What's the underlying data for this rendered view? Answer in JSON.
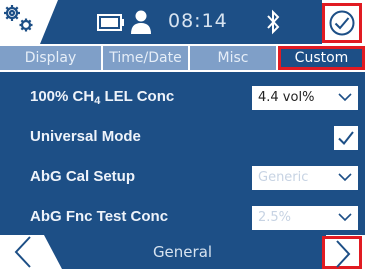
{
  "status_bar": {
    "time": "08:14",
    "icons": [
      "gears-icon",
      "battery-icon",
      "user-icon",
      "bluetooth-icon",
      "checkmark-circle-icon"
    ]
  },
  "tabs": [
    {
      "label": "Display",
      "active": false
    },
    {
      "label": "Time/Date",
      "active": false
    },
    {
      "label": "Misc",
      "active": false
    },
    {
      "label": "Custom",
      "active": true
    }
  ],
  "settings": {
    "lel_conc": {
      "label_main": "100% CH",
      "label_sub": "4",
      "label_tail": " LEL Conc",
      "value": "4.4 vol%"
    },
    "universal_mode": {
      "label": "Universal Mode",
      "checked": true
    },
    "abg_cal_setup": {
      "label": "AbG Cal Setup",
      "value": "Generic",
      "enabled": false
    },
    "abg_fnc_test_conc": {
      "label": "AbG Fnc Test Conc",
      "value": "2.5%",
      "enabled": false
    }
  },
  "footer": {
    "title": "General"
  },
  "colors": {
    "primary": "#1d4f86",
    "tab_inactive": "#7f9fc8",
    "highlight": "#e11b22"
  }
}
